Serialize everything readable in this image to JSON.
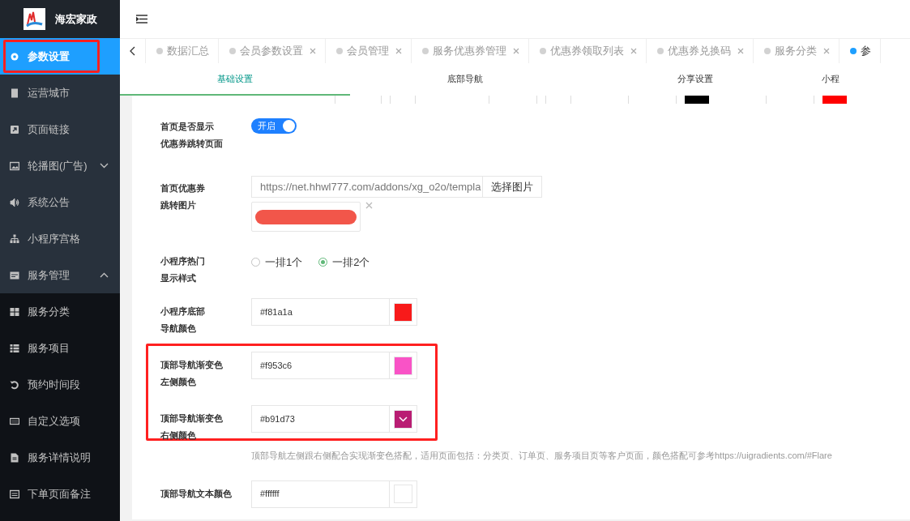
{
  "brand": {
    "name": "海宏家政"
  },
  "sidebar": {
    "items": [
      {
        "label": "参数设置",
        "selected": true
      },
      {
        "label": "运营城市",
        "selected": false
      },
      {
        "label": "页面链接",
        "selected": false
      },
      {
        "label": "轮播图(广告)",
        "selected": false,
        "expanded": false
      },
      {
        "label": "系统公告",
        "selected": false
      },
      {
        "label": "小程序宫格",
        "selected": false
      },
      {
        "label": "服务管理",
        "selected": false,
        "expanded": true,
        "children": [
          {
            "label": "服务分类",
            "selected": false
          },
          {
            "label": "服务项目",
            "selected": false
          },
          {
            "label": "预约时间段",
            "selected": false
          },
          {
            "label": "自定义选项",
            "selected": false
          },
          {
            "label": "服务详情说明",
            "selected": false
          },
          {
            "label": "下单页面备注",
            "selected": false
          }
        ]
      }
    ]
  },
  "tabs": [
    {
      "label": "数据汇总",
      "selected": false,
      "closable": false
    },
    {
      "label": "会员参数设置",
      "selected": false,
      "closable": true
    },
    {
      "label": "会员管理",
      "selected": false,
      "closable": true
    },
    {
      "label": "服务优惠券管理",
      "selected": false,
      "closable": true
    },
    {
      "label": "优惠券领取列表",
      "selected": false,
      "closable": true
    },
    {
      "label": "优惠券兑换码",
      "selected": false,
      "closable": true
    },
    {
      "label": "服务分类",
      "selected": false,
      "closable": true
    },
    {
      "label": "参",
      "selected": true,
      "closable": false
    }
  ],
  "subtabs": [
    {
      "label": "基础设置",
      "selected": true
    },
    {
      "label": "底部导航",
      "selected": false
    },
    {
      "label": "分享设置",
      "selected": false
    },
    {
      "label": "小程",
      "selected": false
    }
  ],
  "form": [
    {
      "kind": "toggle",
      "label": [
        "首页是否显示",
        "优惠券跳转页面"
      ],
      "on": true,
      "toggle_text": "开启"
    },
    {
      "kind": "image",
      "label": [
        "首页优惠券",
        "跳转图片"
      ],
      "value": "https://net.hhwl777.com/addons/xg_o2o/templa",
      "button": "选择图片"
    },
    {
      "kind": "radio",
      "label": [
        "小程序热门",
        "显示样式"
      ],
      "options": [
        {
          "label": "一排1个",
          "selected": false
        },
        {
          "label": "一排2个",
          "selected": true
        }
      ]
    },
    {
      "kind": "color",
      "label": [
        "小程序底部",
        "导航颜色"
      ],
      "value": "#f81a1a",
      "color": "#f81a1a"
    },
    {
      "kind": "color",
      "label": [
        "顶部导航渐变色",
        "左侧颜色"
      ],
      "value": "#f953c6",
      "color": "#f953c6",
      "highlighted": true
    },
    {
      "kind": "color",
      "label": [
        "顶部导航渐变色",
        "右侧颜色"
      ],
      "value": "#b91d73",
      "color": "#b91d73",
      "highlighted": true
    },
    {
      "kind": "hint",
      "text": "顶部导航左侧跟右侧配合实现渐变色搭配，适用页面包括：分类页、订单页、服务项目页等客户页面，颜色搭配可参考https://uigradients.com/#Flare"
    },
    {
      "kind": "color",
      "label": [
        "顶部导航文本颜色"
      ],
      "value": "#ffffff",
      "color": "#ffffff"
    }
  ]
}
